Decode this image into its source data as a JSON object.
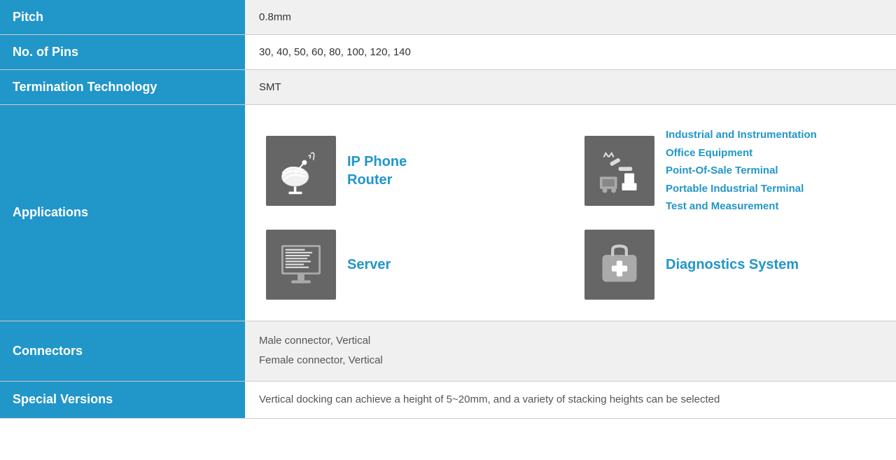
{
  "rows": [
    {
      "id": "pitch",
      "label": "Pitch",
      "value": "0.8mm",
      "bg": "gray"
    },
    {
      "id": "no-of-pins",
      "label": "No. of Pins",
      "value": "30, 40, 50, 60, 80, 100, 120, 140",
      "bg": "white"
    },
    {
      "id": "termination-technology",
      "label": "Termination Technology",
      "value": "SMT",
      "bg": "gray"
    },
    {
      "id": "applications",
      "label": "Applications",
      "bg": "white",
      "type": "applications"
    },
    {
      "id": "connectors",
      "label": "Connectors",
      "bg": "gray",
      "type": "connectors",
      "lines": [
        "Male connector, Vertical",
        "Female connector, Vertical"
      ]
    },
    {
      "id": "special-versions",
      "label": "Special Versions",
      "bg": "white",
      "type": "special",
      "value": "Vertical docking can achieve a height of 5~20mm, and a variety of stacking heights can be selected"
    }
  ],
  "applications": {
    "items": [
      {
        "id": "ip-phone-router",
        "label": "IP Phone\nRouter",
        "type": "satellite"
      },
      {
        "id": "industrial",
        "label": "Industrial and Instrumentation\nOffice Equipment\nPoint-Of-Sale Terminal\nPortable Industrial Terminal\nTest and Measurement",
        "type": "industrial"
      },
      {
        "id": "server",
        "label": "Server",
        "type": "server"
      },
      {
        "id": "diagnostics",
        "label": "Diagnostics System",
        "type": "diagnostics"
      }
    ]
  }
}
